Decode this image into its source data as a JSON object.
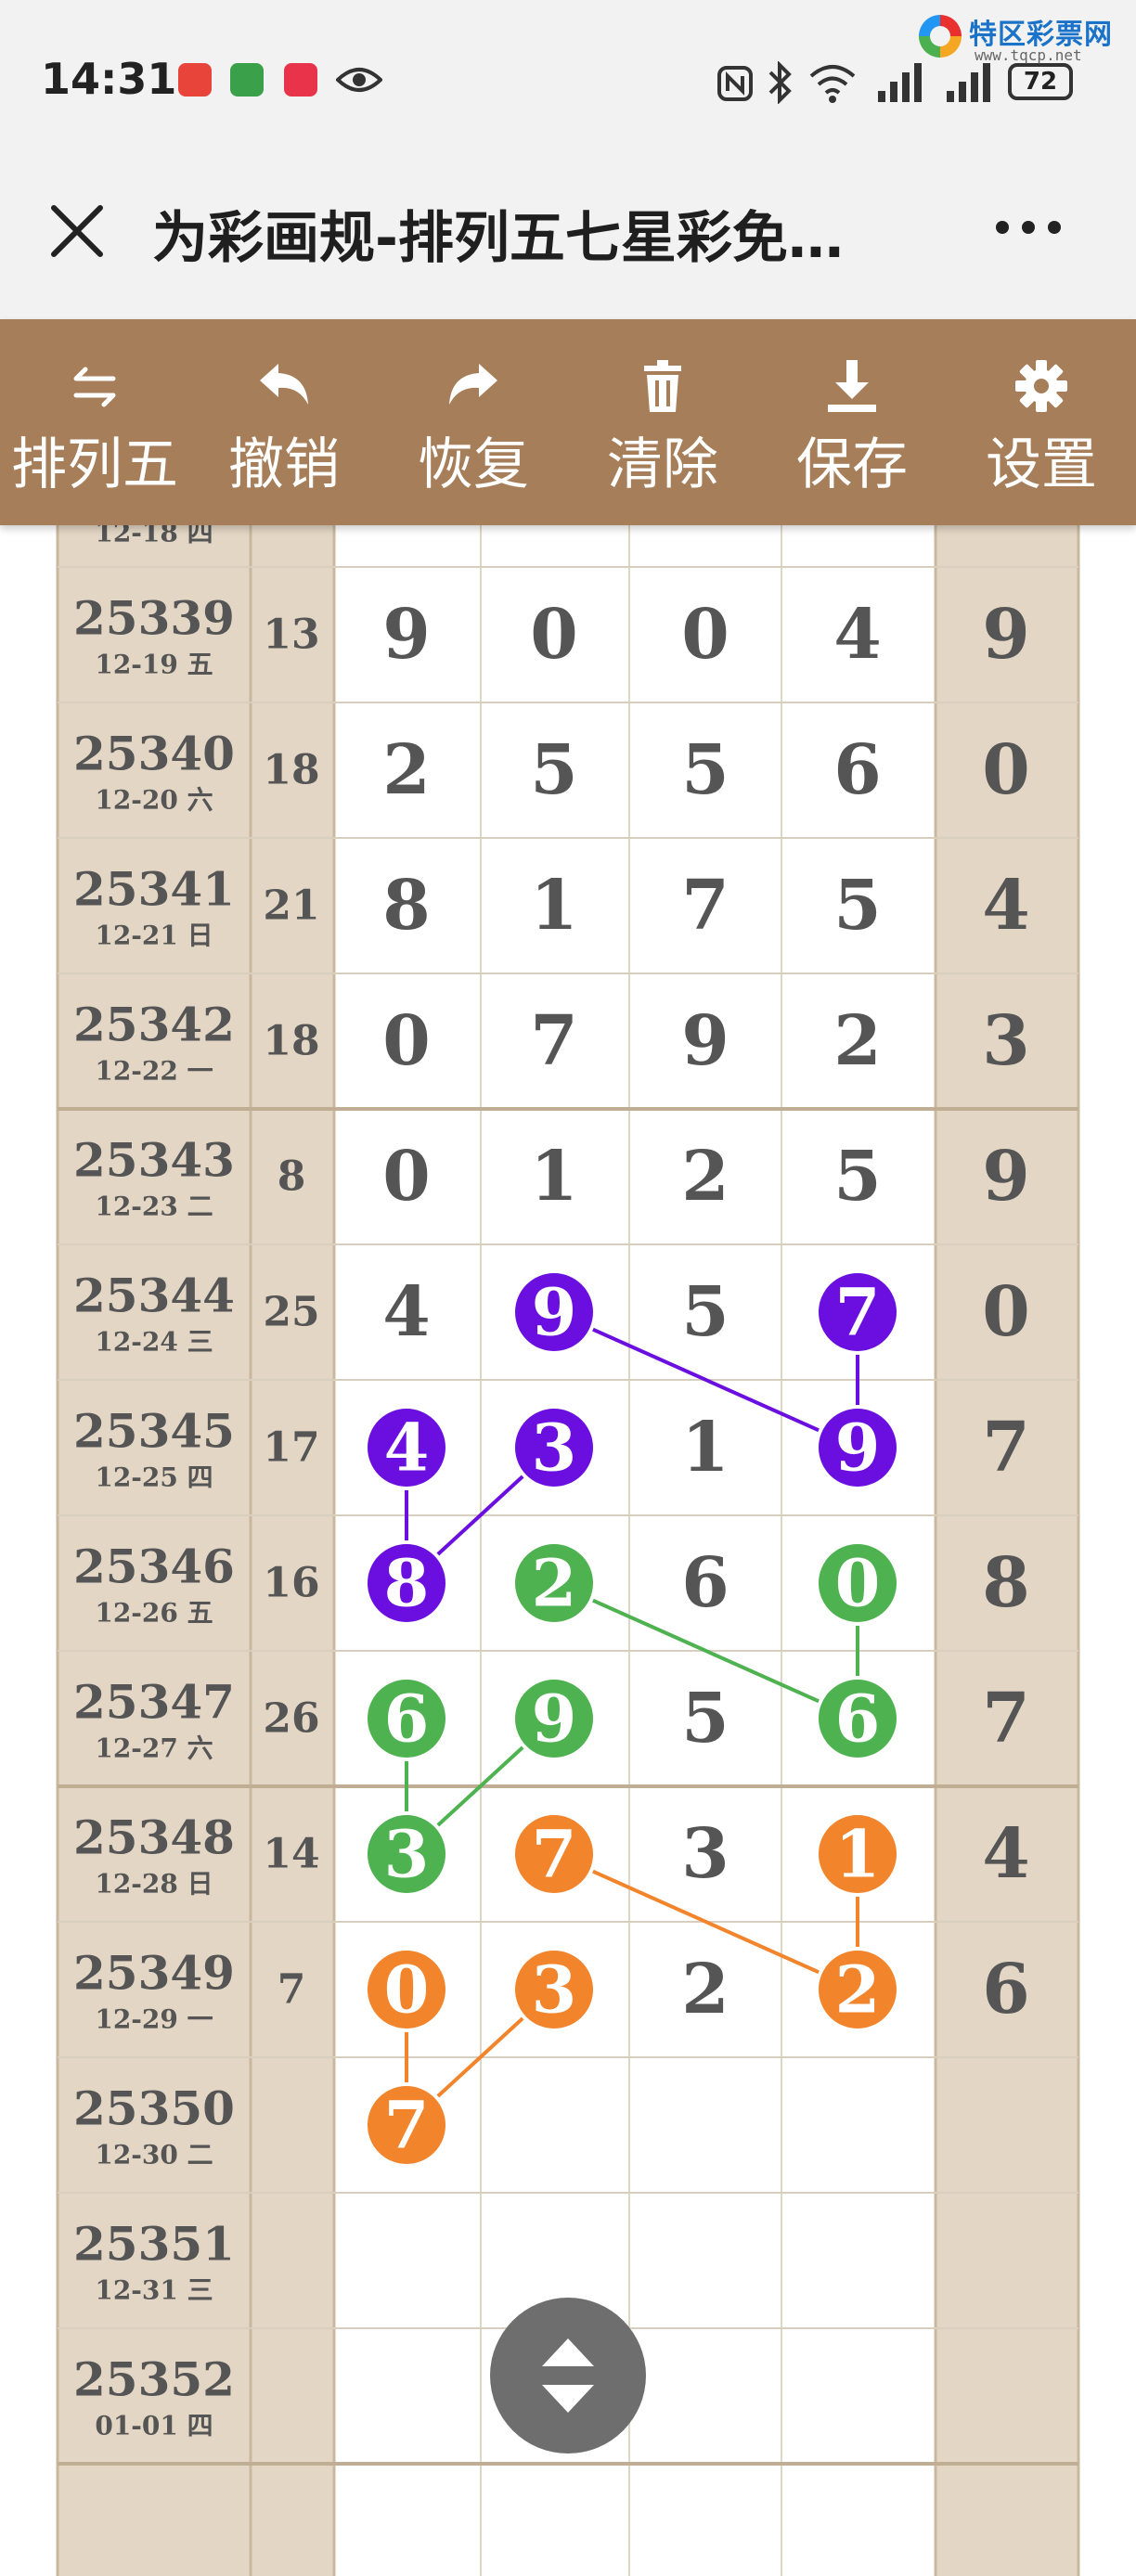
{
  "status_bar": {
    "time": "14:31",
    "battery": "72"
  },
  "watermark": {
    "title": "特区彩票网",
    "url": "www.tqcp.net"
  },
  "header": {
    "title": "为彩画规-排列五七星彩免…"
  },
  "toolbar": {
    "items": [
      {
        "label": "排列五",
        "icon": "swap-icon"
      },
      {
        "label": "撤销",
        "icon": "undo-icon"
      },
      {
        "label": "恢复",
        "icon": "redo-icon"
      },
      {
        "label": "清除",
        "icon": "trash-icon"
      },
      {
        "label": "保存",
        "icon": "download-icon"
      },
      {
        "label": "设置",
        "icon": "gear-icon"
      }
    ]
  },
  "colors": {
    "toolbar": "#a67e59",
    "sidebar": "#e3d6c4",
    "purple": "#6a0fe0",
    "green": "#4db24f",
    "orange": "#f2842b",
    "digit": "#555555"
  },
  "draws": {
    "partial_top": "12-18 四",
    "rows": [
      {
        "issue": "25339",
        "date": "12-19 五",
        "sum": "13",
        "digits": [
          "9",
          "0",
          "0",
          "4"
        ],
        "last": "9"
      },
      {
        "issue": "25340",
        "date": "12-20 六",
        "sum": "18",
        "digits": [
          "2",
          "5",
          "5",
          "6"
        ],
        "last": "0"
      },
      {
        "issue": "25341",
        "date": "12-21 日",
        "sum": "21",
        "digits": [
          "8",
          "1",
          "7",
          "5"
        ],
        "last": "4"
      },
      {
        "issue": "25342",
        "date": "12-22 一",
        "sum": "18",
        "digits": [
          "0",
          "7",
          "9",
          "2"
        ],
        "last": "3"
      },
      {
        "issue": "25343",
        "date": "12-23 二",
        "sum": "8",
        "digits": [
          "0",
          "1",
          "2",
          "5"
        ],
        "last": "9"
      },
      {
        "issue": "25344",
        "date": "12-24 三",
        "sum": "25",
        "digits": [
          "4",
          "9",
          "5",
          "7"
        ],
        "last": "0"
      },
      {
        "issue": "25345",
        "date": "12-25 四",
        "sum": "17",
        "digits": [
          "4",
          "3",
          "1",
          "9"
        ],
        "last": "7"
      },
      {
        "issue": "25346",
        "date": "12-26 五",
        "sum": "16",
        "digits": [
          "8",
          "2",
          "6",
          "0"
        ],
        "last": "8"
      },
      {
        "issue": "25347",
        "date": "12-27 六",
        "sum": "26",
        "digits": [
          "6",
          "9",
          "5",
          "6"
        ],
        "last": "7"
      },
      {
        "issue": "25348",
        "date": "12-28 日",
        "sum": "14",
        "digits": [
          "3",
          "7",
          "3",
          "1"
        ],
        "last": "4"
      },
      {
        "issue": "25349",
        "date": "12-29 一",
        "sum": "7",
        "digits": [
          "0",
          "3",
          "2",
          "2"
        ],
        "last": "6"
      },
      {
        "issue": "25350",
        "date": "12-30 二",
        "sum": "",
        "digits": [
          "7",
          "",
          "",
          ""
        ],
        "last": ""
      },
      {
        "issue": "25351",
        "date": "12-31 三",
        "sum": "",
        "digits": [
          "",
          "",
          "",
          ""
        ],
        "last": ""
      },
      {
        "issue": "25352",
        "date": "01-01 四",
        "sum": "",
        "digits": [
          "",
          "",
          "",
          ""
        ],
        "last": ""
      }
    ]
  },
  "markers": [
    {
      "row": 5,
      "col": 1,
      "color": "purple"
    },
    {
      "row": 5,
      "col": 3,
      "color": "purple"
    },
    {
      "row": 6,
      "col": 0,
      "color": "purple"
    },
    {
      "row": 6,
      "col": 1,
      "color": "purple"
    },
    {
      "row": 6,
      "col": 3,
      "color": "purple"
    },
    {
      "row": 7,
      "col": 0,
      "color": "purple"
    },
    {
      "row": 7,
      "col": 1,
      "color": "green"
    },
    {
      "row": 7,
      "col": 3,
      "color": "green"
    },
    {
      "row": 8,
      "col": 0,
      "color": "green"
    },
    {
      "row": 8,
      "col": 1,
      "color": "green"
    },
    {
      "row": 8,
      "col": 3,
      "color": "green"
    },
    {
      "row": 9,
      "col": 0,
      "color": "green"
    },
    {
      "row": 9,
      "col": 1,
      "color": "orange"
    },
    {
      "row": 9,
      "col": 3,
      "color": "orange"
    },
    {
      "row": 10,
      "col": 0,
      "color": "orange"
    },
    {
      "row": 10,
      "col": 1,
      "color": "orange"
    },
    {
      "row": 10,
      "col": 3,
      "color": "orange"
    },
    {
      "row": 11,
      "col": 0,
      "color": "orange"
    }
  ],
  "links": [
    {
      "from": [
        5,
        3
      ],
      "to": [
        6,
        3
      ],
      "color": "purple"
    },
    {
      "from": [
        5,
        1
      ],
      "to": [
        6,
        3
      ],
      "color": "purple"
    },
    {
      "from": [
        6,
        0
      ],
      "to": [
        7,
        0
      ],
      "color": "purple"
    },
    {
      "from": [
        6,
        1
      ],
      "to": [
        7,
        0
      ],
      "color": "purple"
    },
    {
      "from": [
        7,
        3
      ],
      "to": [
        8,
        3
      ],
      "color": "green"
    },
    {
      "from": [
        7,
        1
      ],
      "to": [
        8,
        3
      ],
      "color": "green"
    },
    {
      "from": [
        8,
        0
      ],
      "to": [
        9,
        0
      ],
      "color": "green"
    },
    {
      "from": [
        8,
        1
      ],
      "to": [
        9,
        0
      ],
      "color": "green"
    },
    {
      "from": [
        9,
        3
      ],
      "to": [
        10,
        3
      ],
      "color": "orange"
    },
    {
      "from": [
        9,
        1
      ],
      "to": [
        10,
        3
      ],
      "color": "orange"
    },
    {
      "from": [
        10,
        0
      ],
      "to": [
        11,
        0
      ],
      "color": "orange"
    },
    {
      "from": [
        10,
        1
      ],
      "to": [
        11,
        0
      ],
      "color": "orange"
    }
  ]
}
